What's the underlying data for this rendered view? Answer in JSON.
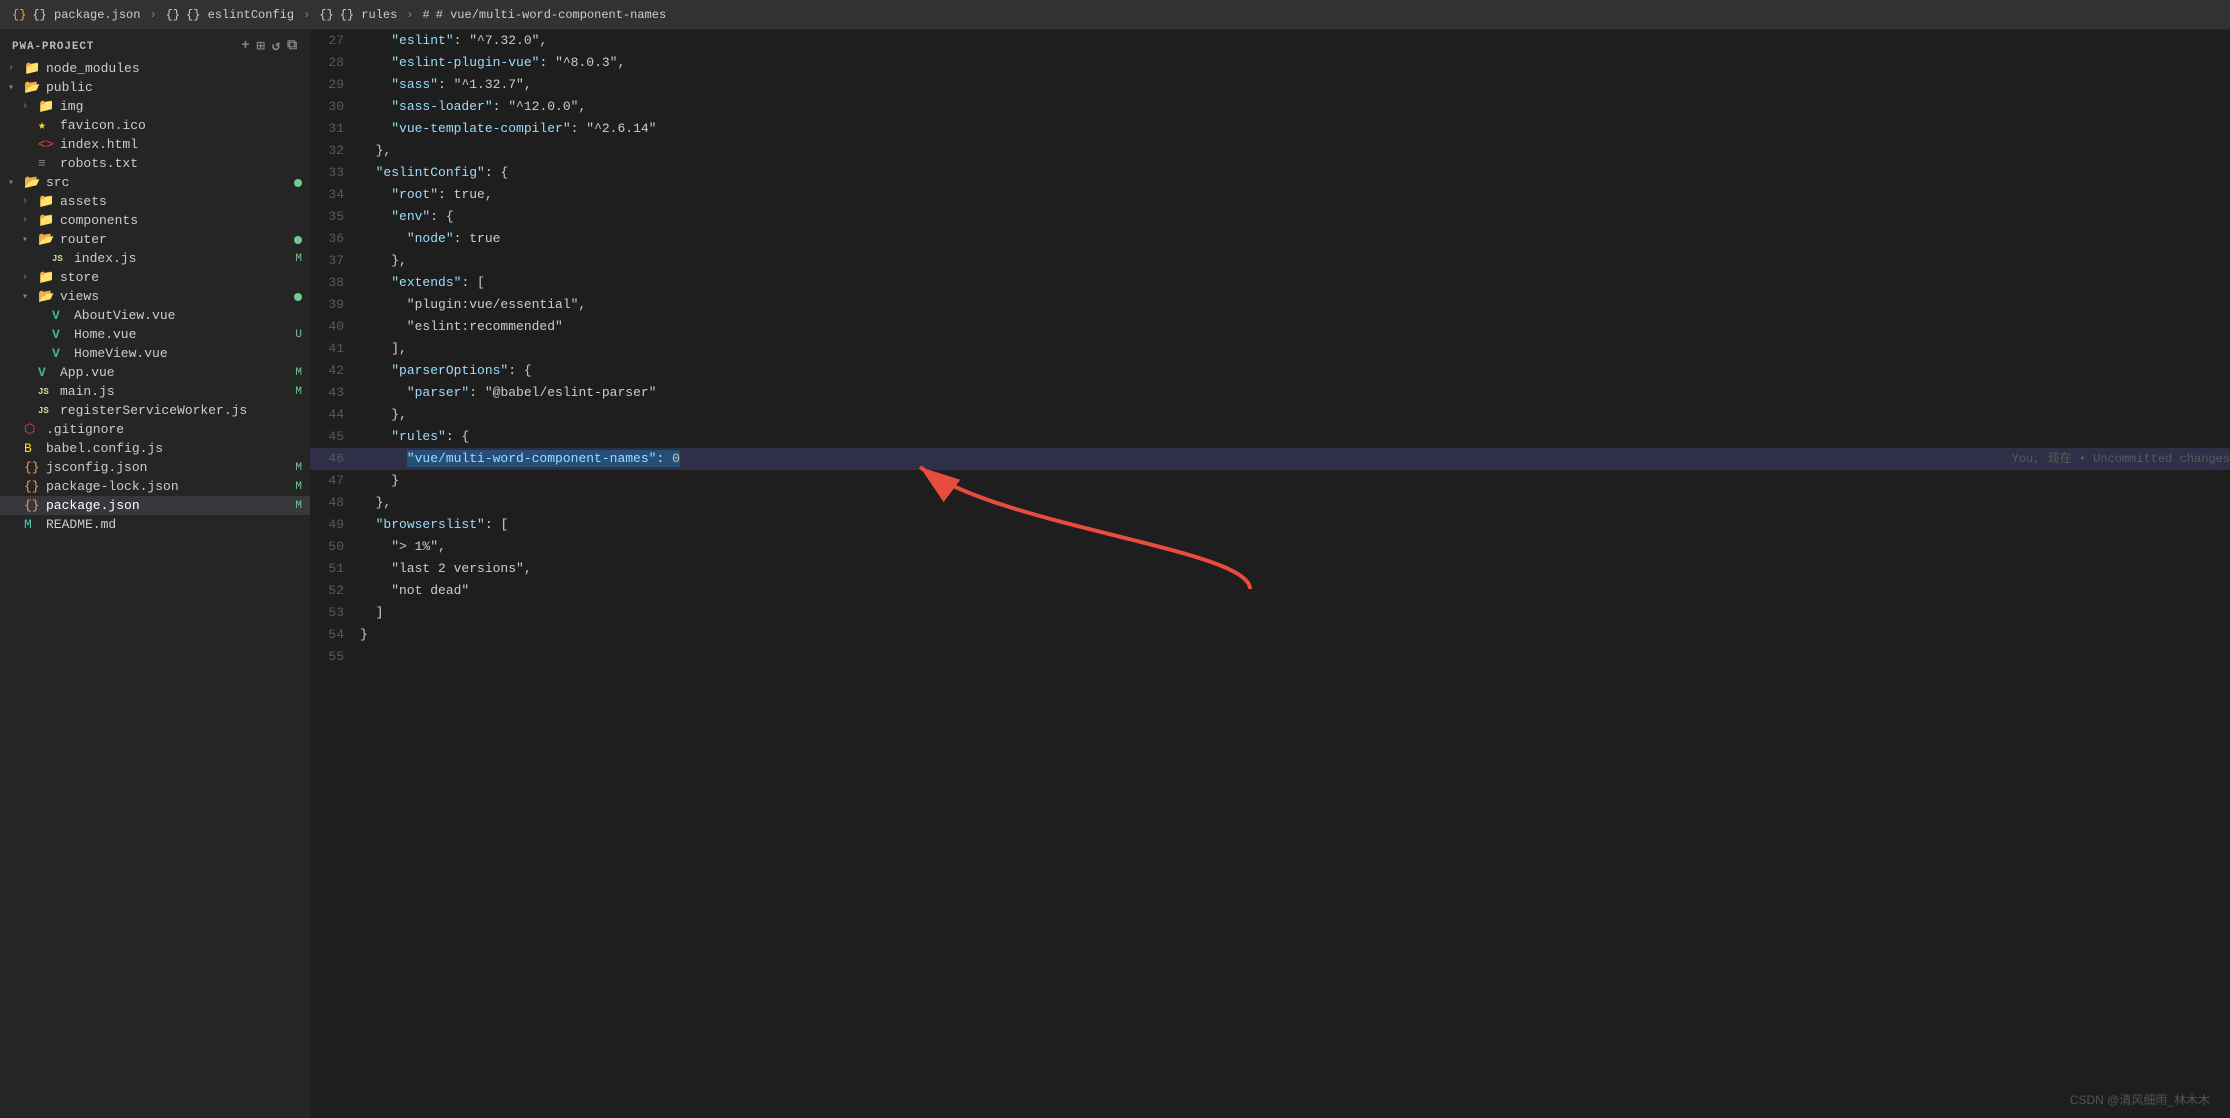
{
  "titlebar": {
    "breadcrumbs": [
      {
        "label": "{} package.json",
        "icon": "json"
      },
      {
        "label": "{} eslintConfig",
        "icon": "json"
      },
      {
        "label": "{} rules",
        "icon": "json"
      },
      {
        "label": "# vue/multi-word-component-names",
        "icon": "hash"
      }
    ]
  },
  "sidebar": {
    "header": "PWA-PROJECT",
    "tree": [
      {
        "id": "node_modules",
        "label": "node_modules",
        "type": "folder",
        "indent": 0,
        "open": false,
        "badge": ""
      },
      {
        "id": "public",
        "label": "public",
        "type": "folder",
        "indent": 0,
        "open": true,
        "badge": ""
      },
      {
        "id": "img",
        "label": "img",
        "type": "folder",
        "indent": 1,
        "open": false,
        "badge": ""
      },
      {
        "id": "favicon.ico",
        "label": "favicon.ico",
        "type": "favicon",
        "indent": 1,
        "open": false,
        "badge": ""
      },
      {
        "id": "index.html",
        "label": "index.html",
        "type": "html",
        "indent": 1,
        "open": false,
        "badge": ""
      },
      {
        "id": "robots.txt",
        "label": "robots.txt",
        "type": "txt",
        "indent": 1,
        "open": false,
        "badge": ""
      },
      {
        "id": "src",
        "label": "src",
        "type": "folder",
        "indent": 0,
        "open": true,
        "badge": "dot"
      },
      {
        "id": "assets",
        "label": "assets",
        "type": "folder",
        "indent": 1,
        "open": false,
        "badge": ""
      },
      {
        "id": "components",
        "label": "components",
        "type": "folder",
        "indent": 1,
        "open": false,
        "badge": ""
      },
      {
        "id": "router",
        "label": "router",
        "type": "folder",
        "indent": 1,
        "open": true,
        "badge": "dot"
      },
      {
        "id": "router-index.js",
        "label": "index.js",
        "type": "js",
        "indent": 2,
        "open": false,
        "badge": "M"
      },
      {
        "id": "store",
        "label": "store",
        "type": "folder",
        "indent": 1,
        "open": false,
        "badge": ""
      },
      {
        "id": "views",
        "label": "views",
        "type": "folder",
        "indent": 1,
        "open": true,
        "badge": "dot"
      },
      {
        "id": "AboutView.vue",
        "label": "AboutView.vue",
        "type": "vue",
        "indent": 2,
        "open": false,
        "badge": ""
      },
      {
        "id": "Home.vue",
        "label": "Home.vue",
        "type": "vue",
        "indent": 2,
        "open": false,
        "badge": "U"
      },
      {
        "id": "HomeView.vue",
        "label": "HomeView.vue",
        "type": "vue",
        "indent": 2,
        "open": false,
        "badge": ""
      },
      {
        "id": "App.vue",
        "label": "App.vue",
        "type": "vue",
        "indent": 1,
        "open": false,
        "badge": "M"
      },
      {
        "id": "main.js",
        "label": "main.js",
        "type": "js",
        "indent": 1,
        "open": false,
        "badge": "M"
      },
      {
        "id": "registerServiceWorker.js",
        "label": "registerServiceWorker.js",
        "type": "js",
        "indent": 1,
        "open": false,
        "badge": ""
      },
      {
        "id": ".gitignore",
        "label": ".gitignore",
        "type": "git",
        "indent": 0,
        "open": false,
        "badge": ""
      },
      {
        "id": "babel.config.js",
        "label": "babel.config.js",
        "type": "babel",
        "indent": 0,
        "open": false,
        "badge": ""
      },
      {
        "id": "jsconfig.json",
        "label": "jsconfig.json",
        "type": "json",
        "indent": 0,
        "open": false,
        "badge": "M"
      },
      {
        "id": "package-lock.json",
        "label": "package-lock.json",
        "type": "json",
        "indent": 0,
        "open": false,
        "badge": "M"
      },
      {
        "id": "package.json",
        "label": "package.json",
        "type": "json",
        "indent": 0,
        "open": false,
        "badge": "M",
        "active": true
      },
      {
        "id": "README.md",
        "label": "README.md",
        "type": "readme",
        "indent": 0,
        "open": false,
        "badge": ""
      }
    ]
  },
  "editor": {
    "lines": [
      {
        "num": 27,
        "content": "    \"eslint\": \"^7.32.0\",",
        "highlighted": false
      },
      {
        "num": 28,
        "content": "    \"eslint-plugin-vue\": \"^8.0.3\",",
        "highlighted": false
      },
      {
        "num": 29,
        "content": "    \"sass\": \"^1.32.7\",",
        "highlighted": false
      },
      {
        "num": 30,
        "content": "    \"sass-loader\": \"^12.0.0\",",
        "highlighted": false
      },
      {
        "num": 31,
        "content": "    \"vue-template-compiler\": \"^2.6.14\"",
        "highlighted": false
      },
      {
        "num": 32,
        "content": "  },",
        "highlighted": false
      },
      {
        "num": 33,
        "content": "  \"eslintConfig\": {",
        "highlighted": false
      },
      {
        "num": 34,
        "content": "    \"root\": true,",
        "highlighted": false
      },
      {
        "num": 35,
        "content": "    \"env\": {",
        "highlighted": false
      },
      {
        "num": 36,
        "content": "      \"node\": true",
        "highlighted": false
      },
      {
        "num": 37,
        "content": "    },",
        "highlighted": false
      },
      {
        "num": 38,
        "content": "    \"extends\": [",
        "highlighted": false
      },
      {
        "num": 39,
        "content": "      \"plugin:vue/essential\",",
        "highlighted": false
      },
      {
        "num": 40,
        "content": "      \"eslint:recommended\"",
        "highlighted": false
      },
      {
        "num": 41,
        "content": "    ],",
        "highlighted": false
      },
      {
        "num": 42,
        "content": "    \"parserOptions\": {",
        "highlighted": false
      },
      {
        "num": 43,
        "content": "      \"parser\": \"@babel/eslint-parser\"",
        "highlighted": false
      },
      {
        "num": 44,
        "content": "    },",
        "highlighted": false
      },
      {
        "num": 45,
        "content": "    \"rules\": {",
        "highlighted": false
      },
      {
        "num": 46,
        "content": "      \"vue/multi-word-component-names\": 0",
        "highlighted": true,
        "blame": "You, 现在 • Uncommitted changes"
      },
      {
        "num": 47,
        "content": "    }",
        "highlighted": false
      },
      {
        "num": 48,
        "content": "  },",
        "highlighted": false
      },
      {
        "num": 49,
        "content": "  \"browserslist\": [",
        "highlighted": false
      },
      {
        "num": 50,
        "content": "    \"> 1%\",",
        "highlighted": false
      },
      {
        "num": 51,
        "content": "    \"last 2 versions\",",
        "highlighted": false
      },
      {
        "num": 52,
        "content": "    \"not dead\"",
        "highlighted": false
      },
      {
        "num": 53,
        "content": "  ]",
        "highlighted": false
      },
      {
        "num": 54,
        "content": "}",
        "highlighted": false
      },
      {
        "num": 55,
        "content": "",
        "highlighted": false
      }
    ]
  },
  "watermark": "CSDN @清风细雨_林木木"
}
